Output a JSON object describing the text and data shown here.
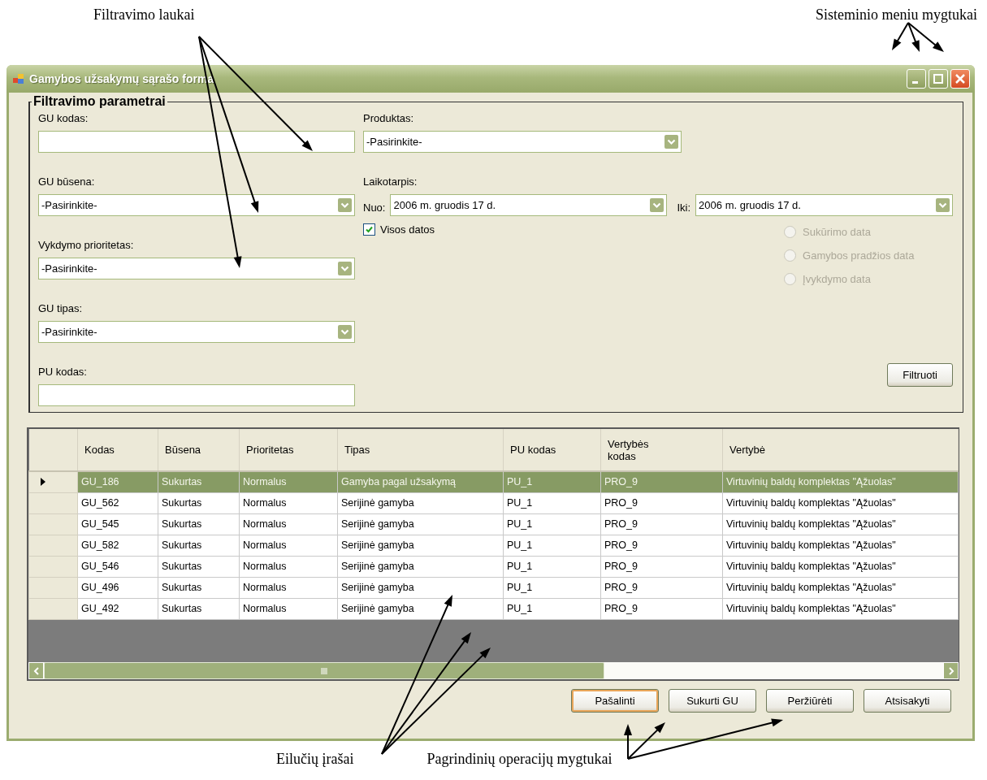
{
  "annotations": [
    {
      "text": "Filtravimo laukai"
    },
    {
      "text": "Sisteminio meniu mygtukai"
    },
    {
      "text": "Eilučių įrašai"
    },
    {
      "text": "Pagrindinių operacijų mygtukai"
    }
  ],
  "window": {
    "title": "Gamybos užsakymų sąrašo forma"
  },
  "filter": {
    "title": "Filtravimo parametrai",
    "left_fields": [
      {
        "kind": "text",
        "label": "GU kodas:"
      },
      {
        "kind": "combo",
        "label": "GU būsena:",
        "value": "-Pasirinkite-"
      },
      {
        "kind": "combo",
        "label": "Vykdymo prioritetas:",
        "value": "-Pasirinkite-"
      },
      {
        "kind": "combo",
        "label": "GU tipas:",
        "value": "-Pasirinkite-"
      },
      {
        "kind": "text",
        "label": "PU kodas:"
      }
    ],
    "product": {
      "label": "Produktas:",
      "value": "-Pasirinkite-"
    },
    "period": {
      "label": "Laikotarpis:",
      "from_label": "Nuo:",
      "from": "2006 m.  gruodis  17 d.",
      "to_label": "Iki:",
      "to": "2006 m.  gruodis  17 d."
    },
    "all_dates": {
      "label": "Visos datos",
      "checked": true
    },
    "date_types": [
      {
        "label": "Sukūrimo data",
        "selected": false,
        "disabled": true
      },
      {
        "label": "Gamybos pradžios data",
        "selected": false,
        "disabled": true
      },
      {
        "label": "Įvykdymo data",
        "selected": false,
        "disabled": true
      }
    ],
    "filter_button": "Filtruoti"
  },
  "table": {
    "columns": [
      "Kodas",
      "Būsena",
      "Prioritetas",
      "Tipas",
      "PU kodas",
      "Vertybės kodas",
      "Vertybė"
    ],
    "rows": [
      {
        "selected": true,
        "cells": [
          "GU_186",
          "Sukurtas",
          "Normalus",
          "Gamyba pagal užsakymą",
          "PU_1",
          "PRO_9",
          "Virtuvinių baldų komplektas \"Ąžuolas\""
        ]
      },
      {
        "selected": false,
        "cells": [
          "GU_562",
          "Sukurtas",
          "Normalus",
          "Serijinė gamyba",
          "PU_1",
          "PRO_9",
          "Virtuvinių baldų komplektas \"Ąžuolas\""
        ]
      },
      {
        "selected": false,
        "cells": [
          "GU_545",
          "Sukurtas",
          "Normalus",
          "Serijinė gamyba",
          "PU_1",
          "PRO_9",
          "Virtuvinių baldų komplektas \"Ąžuolas\""
        ]
      },
      {
        "selected": false,
        "cells": [
          "GU_582",
          "Sukurtas",
          "Normalus",
          "Serijinė gamyba",
          "PU_1",
          "PRO_9",
          "Virtuvinių baldų komplektas \"Ąžuolas\""
        ]
      },
      {
        "selected": false,
        "cells": [
          "GU_546",
          "Sukurtas",
          "Normalus",
          "Serijinė gamyba",
          "PU_1",
          "PRO_9",
          "Virtuvinių baldų komplektas \"Ąžuolas\""
        ]
      },
      {
        "selected": false,
        "cells": [
          "GU_496",
          "Sukurtas",
          "Normalus",
          "Serijinė gamyba",
          "PU_1",
          "PRO_9",
          "Virtuvinių baldų komplektas \"Ąžuolas\""
        ]
      },
      {
        "selected": false,
        "cells": [
          "GU_492",
          "Sukurtas",
          "Normalus",
          "Serijinė gamyba",
          "PU_1",
          "PRO_9",
          "Virtuvinių baldų komplektas \"Ąžuolas\""
        ]
      }
    ]
  },
  "buttons": [
    {
      "label": "Pašalinti",
      "focused": true
    },
    {
      "label": "Sukurti GU",
      "focused": false
    },
    {
      "label": "Peržiūrėti",
      "focused": false
    },
    {
      "label": "Atsisakyti",
      "focused": false
    }
  ]
}
